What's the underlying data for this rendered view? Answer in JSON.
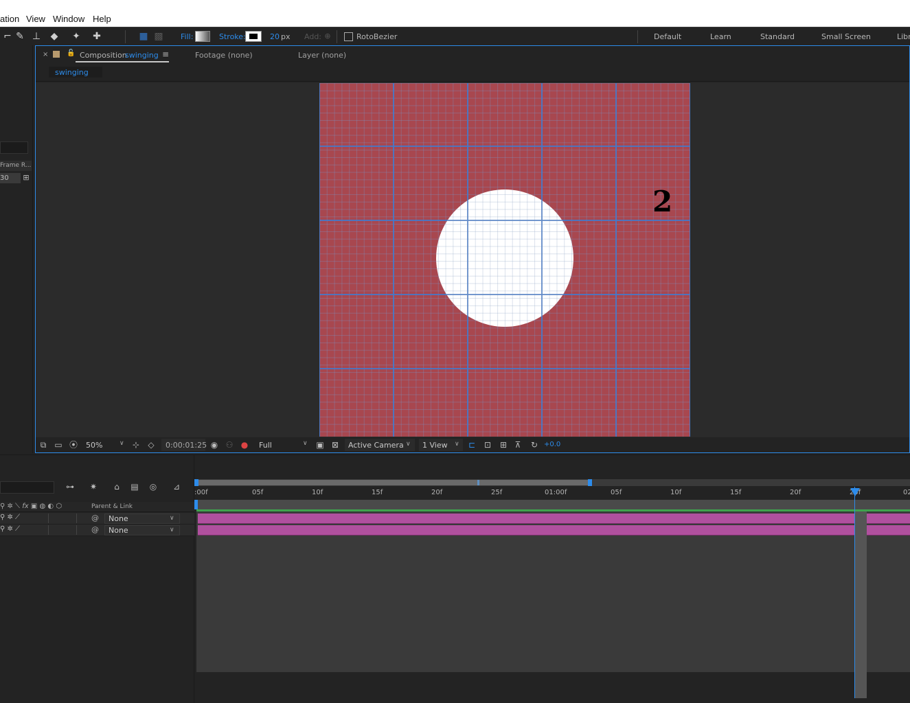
{
  "menubar": {
    "items": [
      "ation",
      "View",
      "Window",
      "Help"
    ]
  },
  "toolbar": {
    "fill_label": "Fill:",
    "stroke_label": "Stroke:",
    "stroke_width": "20",
    "stroke_unit": "px",
    "add_label": "Add:",
    "rotobezier_label": "RotoBezier",
    "workspaces": [
      "Default",
      "Learn",
      "Standard",
      "Small Screen",
      "Libr"
    ]
  },
  "left_panel": {
    "col_header": "Frame R...",
    "frame_rate": "30"
  },
  "comp_panel": {
    "tab_prefix": "Composition",
    "tab_name": "swinging",
    "footage_tab": "Footage (none)",
    "layer_tab": "Layer (none)",
    "subtab": "swinging",
    "canvas_number": "2",
    "zoom": "50%",
    "timecode": "0:00:01:25",
    "resolution": "Full",
    "camera": "Active Camera",
    "views": "1 View",
    "exposure": "+0.0"
  },
  "timeline": {
    "parent_header": "Parent & Link",
    "layers": [
      {
        "parent": "None"
      },
      {
        "parent": "None"
      }
    ],
    "ruler_labels": [
      ":00f",
      "05f",
      "10f",
      "15f",
      "20f",
      "25f",
      "01:00f",
      "05f",
      "10f",
      "15f",
      "20f",
      "25f",
      "02"
    ]
  },
  "colors": {
    "accent": "#2d8ceb",
    "canvas_bg": "#a8474f",
    "layer_bar": "#b0509e",
    "timeline_green": "#3fa34d"
  }
}
